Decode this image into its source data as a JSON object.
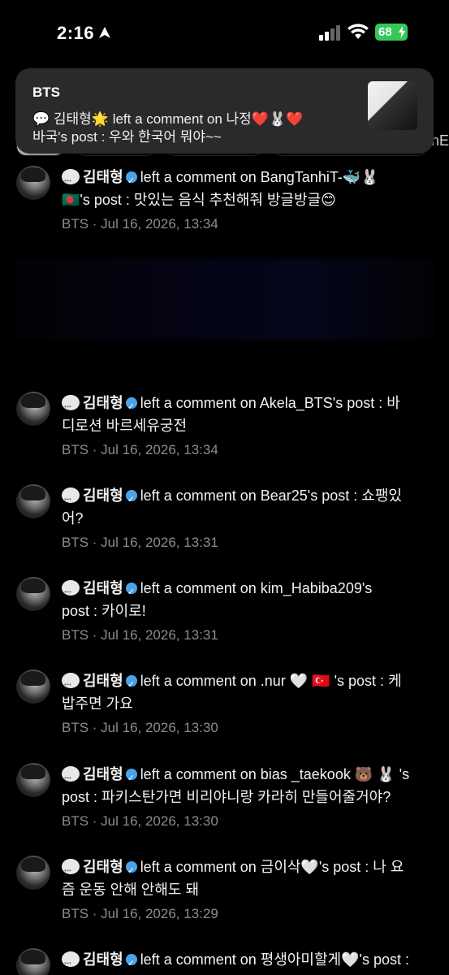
{
  "status": {
    "time": "2:16",
    "battery": "68"
  },
  "chips": {
    "partial_text": "nE"
  },
  "banner": {
    "title": "BTS",
    "line1": "💬 김태형🌟 left a comment on 나정❤️🐰❤️",
    "line2": "바국's post : 우와 한국어 뭐야~~"
  },
  "notifications": [
    {
      "user": "김태형",
      "text": "left a comment on BangTanhiT-🐳🐰",
      "text2": "🇧🇩's post : 맛있는 음식 추천해줘 방글방글😊",
      "meta": "BTS · Jul 16, 2026, 13:34"
    },
    {
      "user": "김태형",
      "text": "left a comment on Akela_BTS's post : 바",
      "text2": "디로션 바르세유궁전",
      "meta": "BTS · Jul 16, 2026, 13:34"
    },
    {
      "user": "김태형",
      "text": "left a comment on Bear25's post : 쇼팽있",
      "text2": "어?",
      "meta": "BTS · Jul 16, 2026, 13:31"
    },
    {
      "user": "김태형",
      "text": "left a comment on kim_Habiba209's",
      "text2": "post : 카이로!",
      "meta": "BTS · Jul 16, 2026, 13:31"
    },
    {
      "user": "김태형",
      "text": "left a comment on .nur 🤍 🇹🇷 's post : 케",
      "text2": "밥주면 가요",
      "meta": "BTS · Jul 16, 2026, 13:30"
    },
    {
      "user": "김태형",
      "text": "left a comment on bias _taekook 🐻 🐰 's",
      "text2": "post : 파키스탄가면 비리야니랑 카라히 만들어줄거야?",
      "meta": "BTS · Jul 16, 2026, 13:30"
    },
    {
      "user": "김태형",
      "text": "left a comment on 금이삭🤍's post : 나 요",
      "text2": "즘 운동 안해 안해도 돼",
      "meta": "BTS · Jul 16, 2026, 13:29"
    },
    {
      "user": "김태형",
      "text": "left a comment on 평생아미할게🤍's post :",
      "text2": "",
      "meta": ""
    }
  ]
}
